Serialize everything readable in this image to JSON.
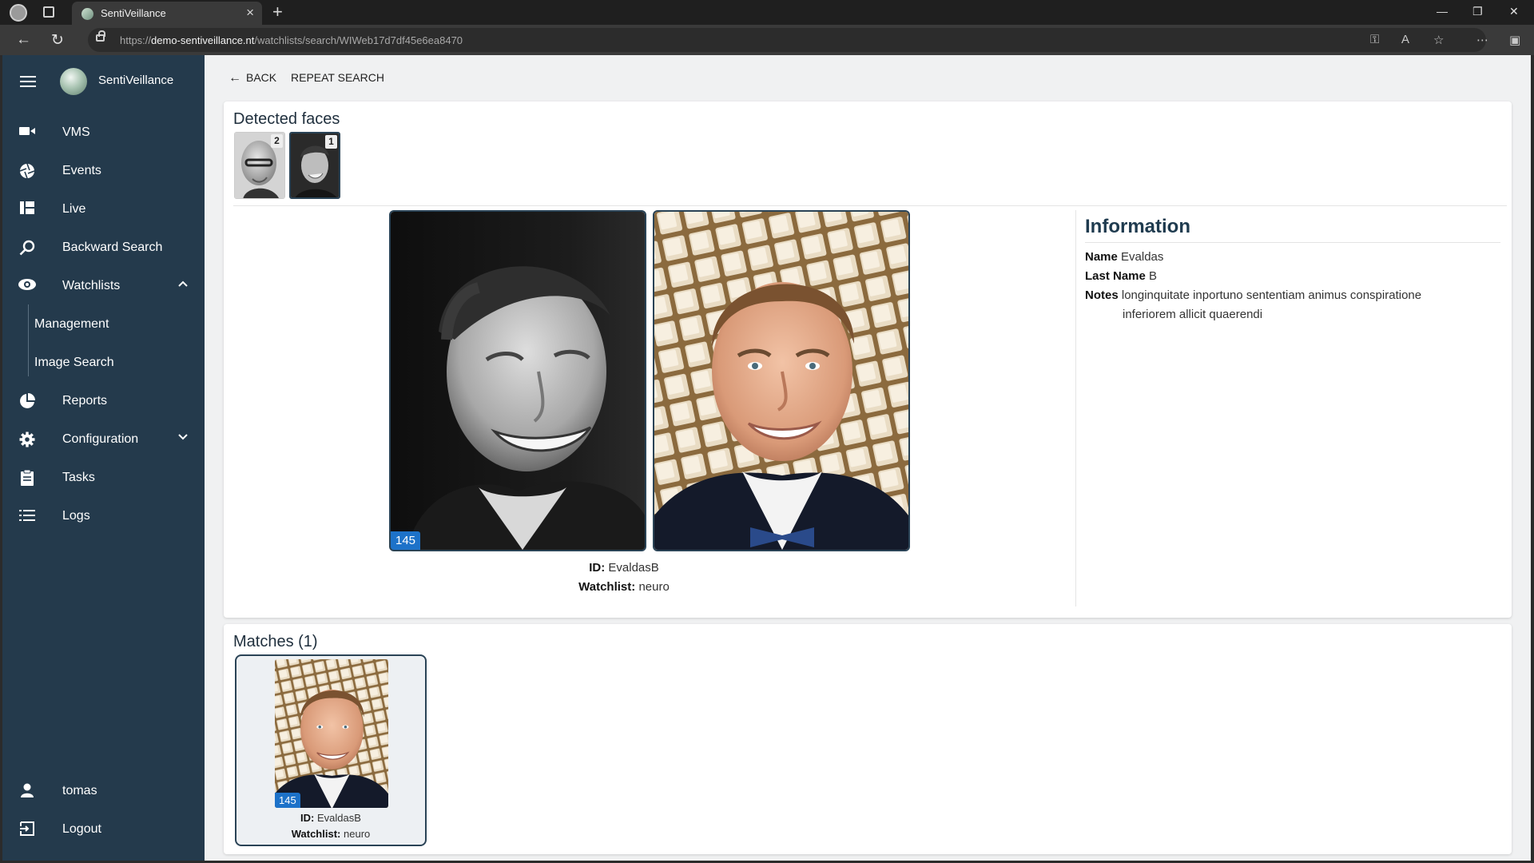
{
  "browser": {
    "tab_title": "SentiVeillance",
    "url_scheme": "https://",
    "url_host": "demo-sentiveillance.nt",
    "url_path": "/watchlists/search/WIWeb17d7df45e6ea8470"
  },
  "app": {
    "brand": "SentiVeillance",
    "menu": [
      {
        "label": "VMS",
        "icon": "video-camera-icon"
      },
      {
        "label": "Events",
        "icon": "aperture-icon"
      },
      {
        "label": "Live",
        "icon": "grid-icon"
      },
      {
        "label": "Backward Search",
        "icon": "search-icon"
      },
      {
        "label": "Watchlists",
        "icon": "eye-icon"
      },
      {
        "label": "Reports",
        "icon": "pie-chart-icon"
      },
      {
        "label": "Configuration",
        "icon": "gear-icon"
      },
      {
        "label": "Tasks",
        "icon": "clipboard-icon"
      },
      {
        "label": "Logs",
        "icon": "list-icon"
      }
    ],
    "submenu": [
      {
        "label": "Management"
      },
      {
        "label": "Image Search"
      }
    ],
    "user": "tomas",
    "logout": "Logout"
  },
  "toolbar": {
    "back_label": "BACK",
    "repeat_label": "REPEAT SEARCH"
  },
  "detected": {
    "title": "Detected faces",
    "faces": [
      {
        "badge": "2"
      },
      {
        "badge": "1"
      }
    ],
    "score": "145",
    "id_label": "ID:",
    "id_value": "EvaldasB",
    "watchlist_label": "Watchlist:",
    "watchlist_value": "neuro"
  },
  "information": {
    "title": "Information",
    "name_label": "Name",
    "name_value": "Evaldas",
    "lastname_label": "Last Name",
    "lastname_value": "B",
    "notes_label": "Notes",
    "notes_line1": "longinquitate inportuno sententiam animus conspiratione",
    "notes_line2": "inferiorem allicit quaerendi"
  },
  "matches": {
    "title": "Matches (1)",
    "items": [
      {
        "score": "145",
        "id_label": "ID:",
        "id_value": "EvaldasB",
        "watchlist_label": "Watchlist:",
        "watchlist_value": "neuro"
      }
    ]
  }
}
